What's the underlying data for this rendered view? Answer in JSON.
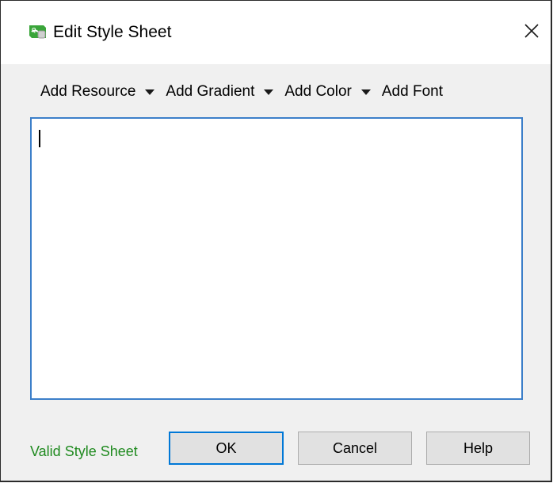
{
  "window": {
    "title": "Edit Style Sheet",
    "icon": "qt-designer-icon",
    "close_icon": "close-icon"
  },
  "toolbar": {
    "items": [
      {
        "label": "Add Resource",
        "has_dropdown": true
      },
      {
        "label": "Add Gradient",
        "has_dropdown": true
      },
      {
        "label": "Add Color",
        "has_dropdown": true
      },
      {
        "label": "Add Font",
        "has_dropdown": false
      }
    ]
  },
  "editor": {
    "value": ""
  },
  "status": {
    "text": "Valid Style Sheet",
    "color": "#1f8a1f"
  },
  "buttons": {
    "ok": "OK",
    "cancel": "Cancel",
    "help": "Help"
  },
  "colors": {
    "focus_border": "#3c7fc9",
    "default_button_border": "#0078d7"
  }
}
